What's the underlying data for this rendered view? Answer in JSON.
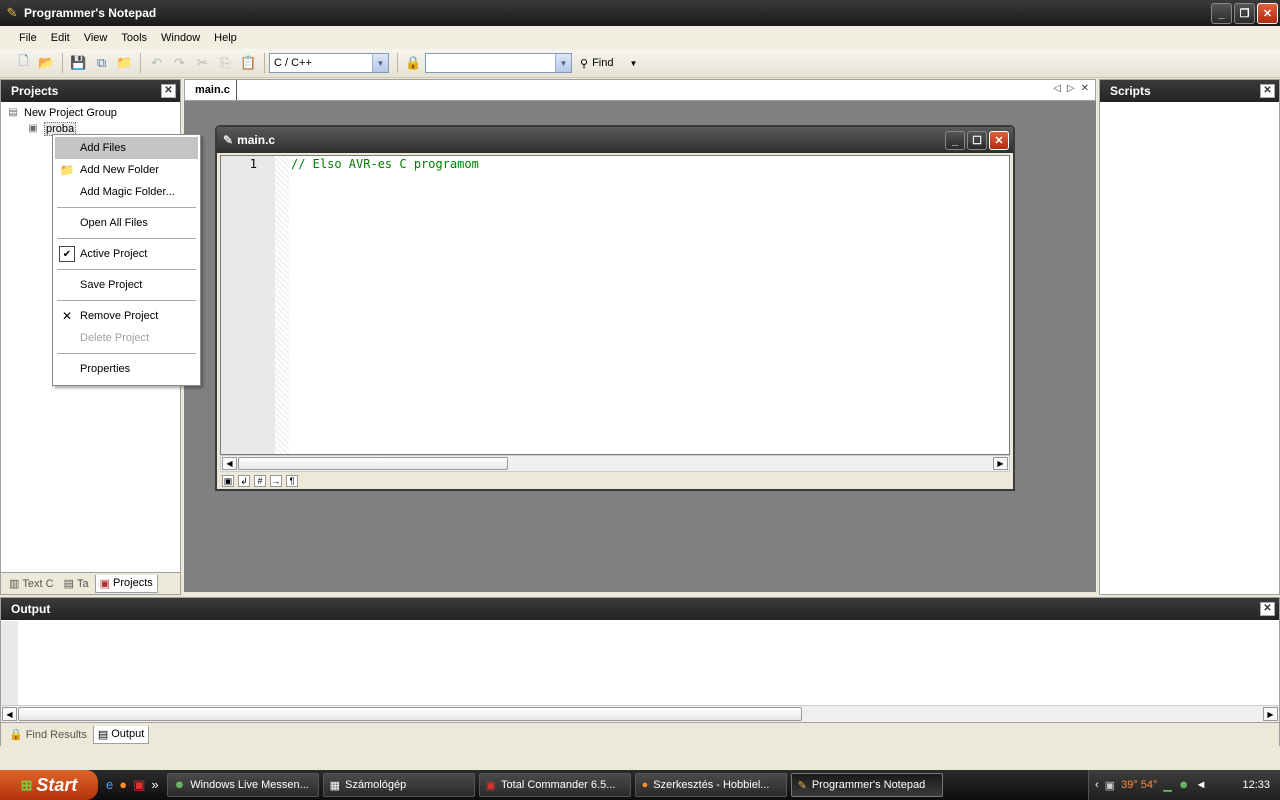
{
  "app": {
    "title": "Programmer's Notepad"
  },
  "menu": [
    "File",
    "Edit",
    "View",
    "Tools",
    "Window",
    "Help"
  ],
  "toolbar": {
    "scheme": "C / C++",
    "find_combo": "",
    "find_label": "Find"
  },
  "projects_panel": {
    "title": "Projects",
    "tree": {
      "group": "New Project Group",
      "project": "proba"
    },
    "tabs": [
      "Text C",
      "Ta",
      "Projects"
    ]
  },
  "editor": {
    "tab": "main.c",
    "window_title": "main.c",
    "line_number": "1",
    "code": "// Elso AVR-es C programom"
  },
  "context_menu": {
    "items": [
      "Add Files",
      "Add New Folder",
      "Add Magic Folder...",
      "Open All Files",
      "Active Project",
      "Save Project",
      "Remove Project",
      "Delete Project",
      "Properties"
    ]
  },
  "scripts_panel": {
    "title": "Scripts"
  },
  "output_panel": {
    "title": "Output",
    "tabs": [
      "Find Results",
      "Output"
    ]
  },
  "taskbar": {
    "start": "Start",
    "tasks": [
      "Windows Live Messen...",
      "Számológép",
      "Total Commander 6.5...",
      "Szerkesztés - Hobbiel...",
      "Programmer's Notepad"
    ],
    "temp": "39° 54°",
    "clock": "12:33"
  }
}
